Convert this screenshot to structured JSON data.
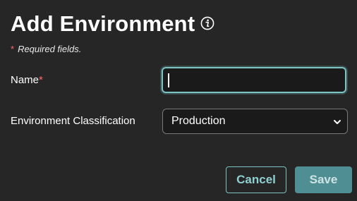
{
  "dialog": {
    "title": "Add Environment",
    "required_note_star": "*",
    "required_note": "Required fields."
  },
  "form": {
    "name": {
      "label": "Name",
      "required_mark": "*",
      "value": ""
    },
    "classification": {
      "label": "Environment Classification",
      "selected": "Production"
    }
  },
  "actions": {
    "cancel_label": "Cancel",
    "save_label": "Save"
  },
  "icons": {
    "info": "info-icon",
    "dropdown": "chevron-down-icon"
  },
  "colors": {
    "background": "#262626",
    "accent": "#7cc3c3",
    "required": "#ff6a6a",
    "save_button": "#4f8f93"
  }
}
